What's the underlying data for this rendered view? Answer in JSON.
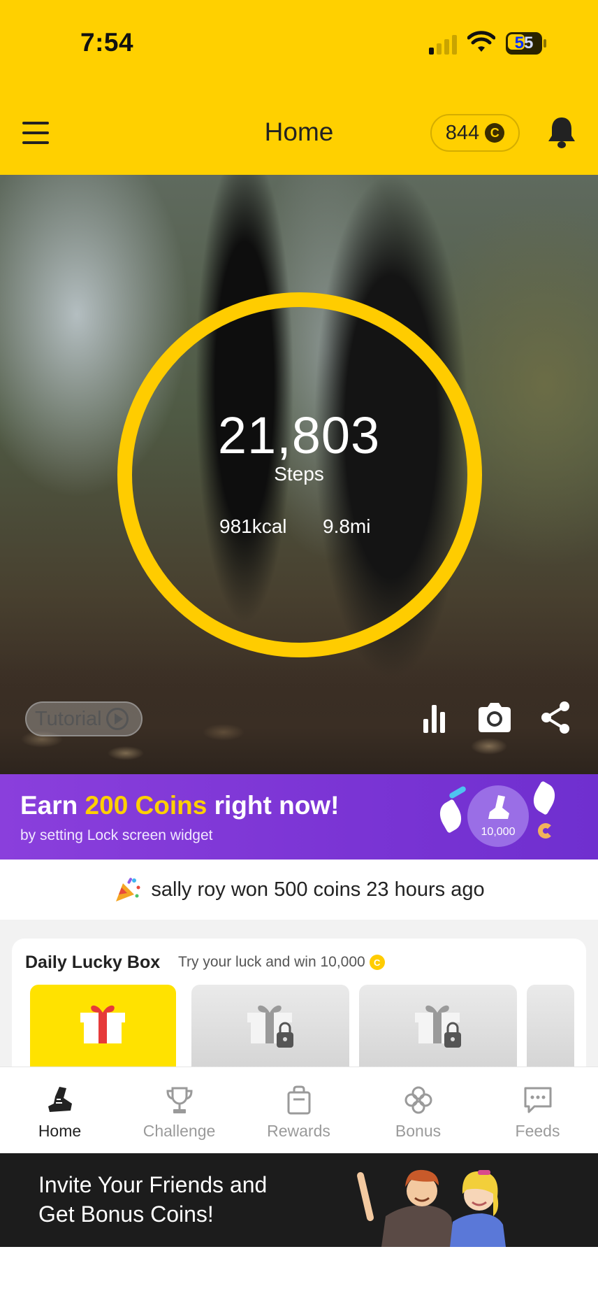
{
  "status_bar": {
    "time": "7:54",
    "battery": "55"
  },
  "header": {
    "title": "Home",
    "coins": "844",
    "coin_symbol": "C"
  },
  "hero": {
    "steps": "21,803",
    "steps_label": "Steps",
    "calories": "981kcal",
    "distance": "9.8mi",
    "tutorial_label": "Tutorial",
    "ring_color": "#FFCC00"
  },
  "promo": {
    "title_prefix": "Earn ",
    "title_highlight": "200 Coins",
    "title_suffix": " right now!",
    "subtitle": "by setting Lock screen widget",
    "badge_value": "10,000"
  },
  "ticker": {
    "text": "sally roy won 500 coins 23 hours ago"
  },
  "lucky_box": {
    "title": "Daily Lucky Box",
    "subtitle": "Try your luck and win 10,000",
    "coin_symbol": "C"
  },
  "tabs": [
    {
      "label": "Home",
      "icon": "sneaker-icon",
      "active": true
    },
    {
      "label": "Challenge",
      "icon": "trophy-icon",
      "active": false
    },
    {
      "label": "Rewards",
      "icon": "shopping-bag-icon",
      "active": false
    },
    {
      "label": "Bonus",
      "icon": "clover-icon",
      "active": false
    },
    {
      "label": "Feeds",
      "icon": "chat-icon",
      "active": false
    }
  ],
  "invite": {
    "line1": "Invite Your Friends and",
    "line2": "Get Bonus Coins!"
  },
  "colors": {
    "brand_yellow": "#FFD000",
    "promo_purple": "#7a34d4",
    "dark_banner": "#1c1c1c"
  }
}
